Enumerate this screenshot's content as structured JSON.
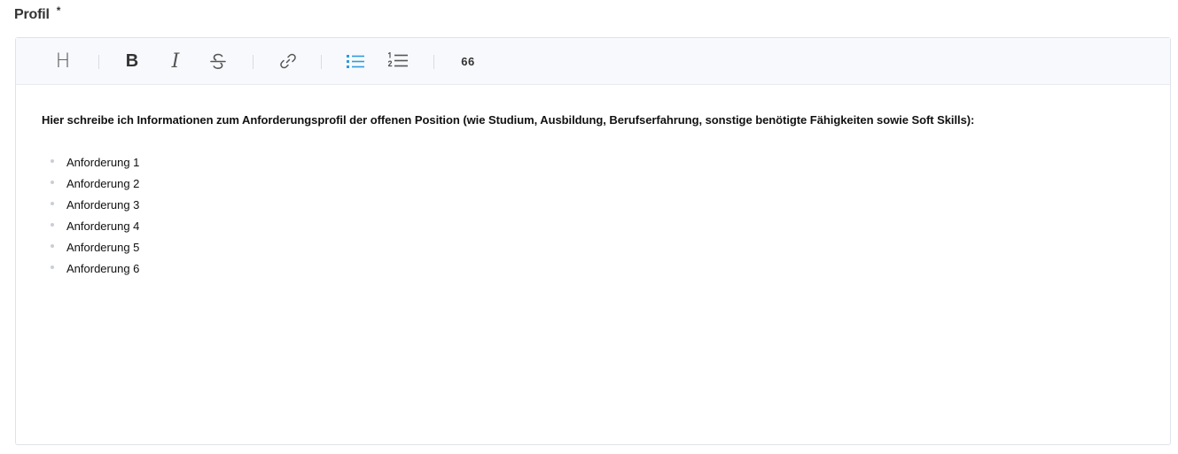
{
  "field": {
    "label": "Profil",
    "required_marker": "*"
  },
  "toolbar": {
    "heading_label": "H",
    "bold_label": "B",
    "italic_label": "I",
    "quote_label": "66",
    "active_color": "#2d9cdb"
  },
  "content": {
    "intro": "Hier schreibe ich Informationen zum Anforderungsprofil der offenen Position (wie Studium, Ausbildung, Berufserfahrung, sonstige benötigte Fähigkeiten sowie Soft Skills):",
    "items": [
      "Anforderung 1",
      "Anforderung 2",
      "Anforderung 3",
      "Anforderung 4",
      "Anforderung 5",
      "Anforderung 6"
    ]
  }
}
